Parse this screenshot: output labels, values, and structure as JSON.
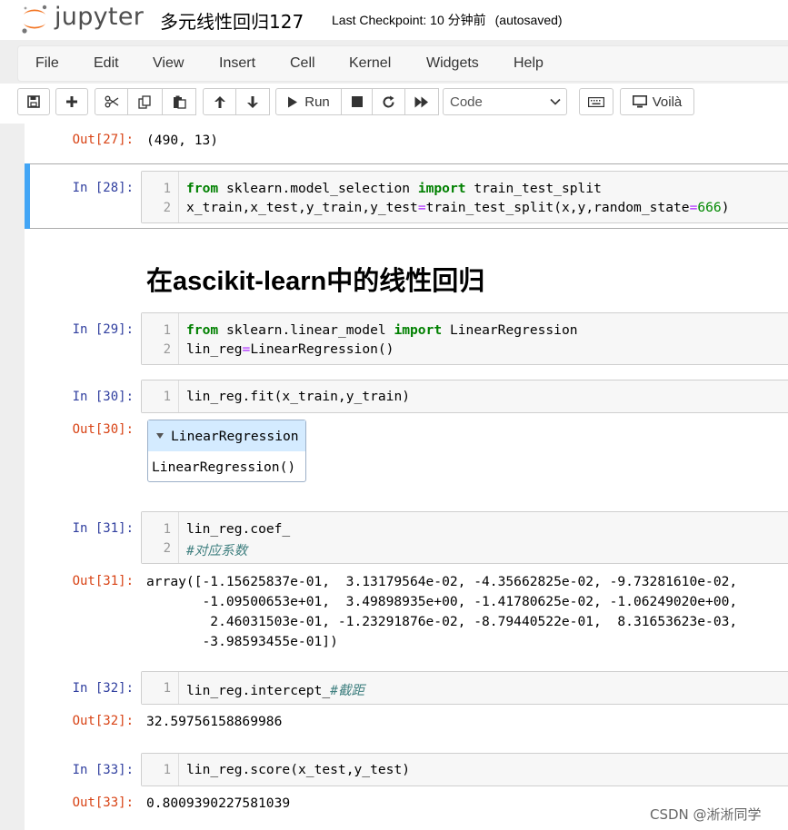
{
  "header": {
    "brand": "jupyter",
    "notebook_title": "多元线性回归127",
    "checkpoint": "Last Checkpoint: 10 分钟前",
    "autosaved": "(autosaved)"
  },
  "menu": [
    "File",
    "Edit",
    "View",
    "Insert",
    "Cell",
    "Kernel",
    "Widgets",
    "Help"
  ],
  "toolbar": {
    "run_label": "Run",
    "cell_type": "Code",
    "voila_label": "Voilà",
    "icons": [
      "save-icon",
      "plus-icon",
      "cut-icon",
      "copy-icon",
      "paste-icon",
      "arrow-up-icon",
      "arrow-down-icon",
      "play-icon",
      "stop-icon",
      "restart-icon",
      "fast-forward-icon",
      "keyboard-icon",
      "monitor-icon"
    ]
  },
  "cells": {
    "out27": {
      "prompt": "Out[27]:",
      "text": "(490, 13)"
    },
    "in28": {
      "prompt": "In  [28]:",
      "lines": [
        "1",
        "2"
      ]
    },
    "heading": "在ascikit-learn中的线性回归",
    "in29": {
      "prompt": "In  [29]:",
      "lines": [
        "1",
        "2"
      ]
    },
    "in30": {
      "prompt": "In  [30]:",
      "lines": [
        "1"
      ]
    },
    "out30": {
      "prompt": "Out[30]:",
      "widget_title": "LinearRegression",
      "widget_body": "LinearRegression()"
    },
    "in31": {
      "prompt": "In  [31]:",
      "lines": [
        "1",
        "2"
      ]
    },
    "out31": {
      "prompt": "Out[31]:",
      "lines": [
        "array([-1.15625837e-01,  3.13179564e-02, -4.35662825e-02, -9.73281610e-02,",
        "       -1.09500653e+01,  3.49898935e+00, -1.41780625e-02, -1.06249020e+00,",
        "        2.46031503e-01, -1.23291876e-02, -8.79440522e-01,  8.31653623e-03,",
        "       -3.98593455e-01])"
      ]
    },
    "in32": {
      "prompt": "In  [32]:",
      "lines": [
        "1"
      ]
    },
    "out32": {
      "prompt": "Out[32]:",
      "text": "32.59756158869986"
    },
    "in33": {
      "prompt": "In  [33]:",
      "lines": [
        "1"
      ]
    },
    "out33": {
      "prompt": "Out[33]:",
      "text": "0.8009390227581039"
    }
  },
  "code": {
    "c28_1_kw1": "from",
    "c28_1_mod": " sklearn.model_selection ",
    "c28_1_kw2": "import",
    "c28_1_rest": " train_test_split",
    "c28_2_a": "x_train,x_test,y_train,y_test",
    "c28_2_eq": "=",
    "c28_2_b": "train_test_split(x,y,random_state",
    "c28_2_eq2": "=",
    "c28_2_num": "666",
    "c28_2_c": ")",
    "c29_1_kw1": "from",
    "c29_1_mod": " sklearn.linear_model ",
    "c29_1_kw2": "import",
    "c29_1_rest": " LinearRegression",
    "c29_2_a": "lin_reg",
    "c29_2_eq": "=",
    "c29_2_b": "LinearRegression()",
    "c30_1": "lin_reg.fit(x_train,y_train)",
    "c31_1": "lin_reg.coef_",
    "c31_2_cmt": "#对应系数",
    "c32_1": "lin_reg.intercept_",
    "c32_1_cmt": "#截距",
    "c33_1": "lin_reg.score(x_test,y_test)"
  },
  "watermark": "CSDN @淅淅同学"
}
